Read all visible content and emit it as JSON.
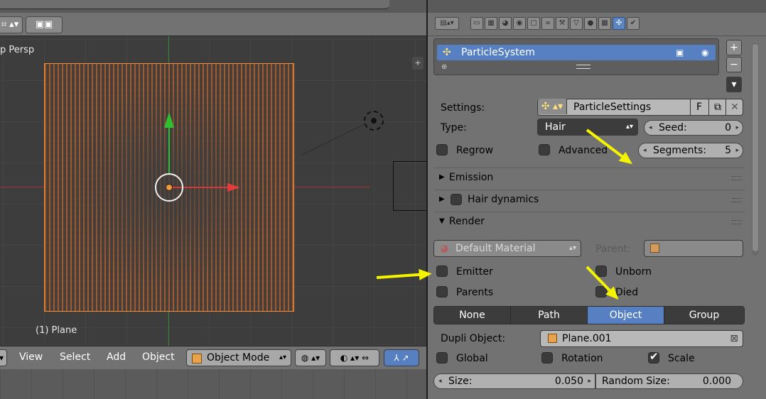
{
  "viewport": {
    "view_label": "p Persp",
    "object_label": "(1) Plane",
    "menu": [
      "View",
      "Select",
      "Add",
      "Object"
    ],
    "mode": "Object Mode"
  },
  "properties": {
    "particle_system": {
      "name": "ParticleSystem"
    },
    "settings": {
      "label": "Settings:",
      "value": "ParticleSettings",
      "fake_user": "F"
    },
    "type": {
      "label": "Type:",
      "value": "Hair"
    },
    "seed": {
      "label": "Seed:",
      "value": "0"
    },
    "regrow_label": "Regrow",
    "advanced_label": "Advanced",
    "segments": {
      "label": "Segments:",
      "value": "5"
    },
    "panels": {
      "emission": "Emission",
      "hair_dynamics": "Hair dynamics",
      "render": "Render"
    },
    "render": {
      "material": "Default Material",
      "parent_label": "Parent:",
      "emitter_label": "Emitter",
      "unborn_label": "Unborn",
      "parents_label": "Parents",
      "died_label": "Died",
      "render_as": [
        "None",
        "Path",
        "Object",
        "Group"
      ],
      "render_as_active": "Object",
      "dupli_label": "Dupli Object:",
      "dupli_value": "Plane.001",
      "global_label": "Global",
      "rotation_label": "Rotation",
      "scale_label": "Scale",
      "scale_checked": true,
      "size_label": "Size:",
      "size_value": "0.050",
      "random_size_label": "Random Size:",
      "random_size_value": "0.000"
    },
    "icons": {
      "context_tabs": [
        "render-icon",
        "render-layers-icon",
        "scene-icon",
        "world-icon",
        "object-icon",
        "constraints-icon",
        "modifiers-icon",
        "data-icon",
        "material-icon",
        "texture-icon",
        "particles-icon",
        "physics-icon"
      ],
      "active_tab": "particles-icon"
    },
    "accent_color": "#5680c2"
  },
  "annotations": {
    "arrow_color": "#f4f400"
  }
}
